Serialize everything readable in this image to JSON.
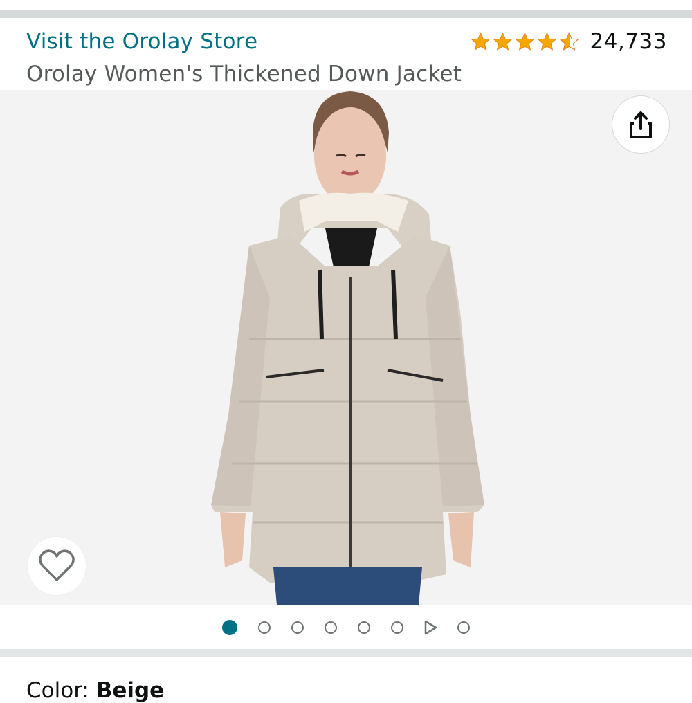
{
  "store": {
    "link_label": "Visit the Orolay Store"
  },
  "product": {
    "title": "Orolay Women's Thickened Down Jacket"
  },
  "rating": {
    "stars": 4.5,
    "count": "24,733",
    "star_color": "#f7a600"
  },
  "gallery": {
    "image_count": 8,
    "active_index": 0,
    "video_index": 6,
    "share_icon": "share-icon",
    "wishlist_icon": "heart-outline-icon"
  },
  "color": {
    "label": "Color:",
    "value": "Beige"
  },
  "colors": {
    "link": "#007185",
    "accent": "#007185",
    "text": "#0f1111",
    "subtext": "#565959"
  }
}
